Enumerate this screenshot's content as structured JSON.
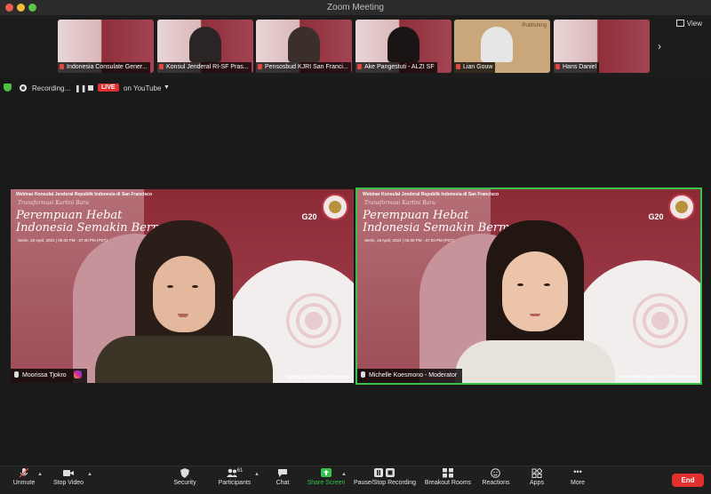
{
  "window": {
    "title": "Zoom Meeting"
  },
  "top_bar": {
    "view_label": "View"
  },
  "thumbnails": [
    {
      "name": "Indonesia Consulate Gener...",
      "muted": true
    },
    {
      "name": "Konsul Jenderal RI-SF Pras...",
      "muted": true
    },
    {
      "name": "Pensosbud KJRI San Franci...",
      "muted": true
    },
    {
      "name": "Ake Pangestuti - ALZI SF",
      "muted": true
    },
    {
      "name": "Lian Gouw",
      "muted": true
    },
    {
      "name": "Hans Daniel",
      "muted": true
    }
  ],
  "thumb_overlay_text": "Publishing",
  "recording": {
    "label": "Recording...",
    "live_badge": "LIVE",
    "stream_target": "on YouTube"
  },
  "webinar": {
    "org_line": "Webinar Konsulat Jenderal Republik Indonesia di San Francisco",
    "series": "Transformasi Kartini Baru",
    "title_line1": "Perempuan Hebat",
    "title_line2": "Indonesia Semakin Bermartabat",
    "date_line": "Senin, 18 April, 2022 | 05.00 PM - 07.00 PM (PDT)",
    "g20_label": "G20",
    "website": "www.kemlu.go.id/sanfrancisco",
    "website_cropped": "kemlu.go.id/sanfrancisco"
  },
  "main_videos": [
    {
      "name": "Moorissa Tjokro",
      "has_instagram_icon": true
    },
    {
      "name": "Michelle Koesmono - Moderator",
      "active_speaker": true
    }
  ],
  "toolbar": {
    "unmute": "Unmute",
    "stop_video": "Stop Video",
    "security": "Security",
    "participants": "Participants",
    "participants_count": "61",
    "chat": "Chat",
    "share_screen": "Share Screen",
    "pause_stop_recording": "Pause/Stop Recording",
    "breakout_rooms": "Breakout Rooms",
    "reactions": "Reactions",
    "apps": "Apps",
    "more": "More",
    "end": "End"
  },
  "colors": {
    "active_speaker": "#37c24d",
    "end_button": "#e0312f",
    "live_badge": "#e0312f",
    "slide_maroon": "#8c2a36"
  }
}
